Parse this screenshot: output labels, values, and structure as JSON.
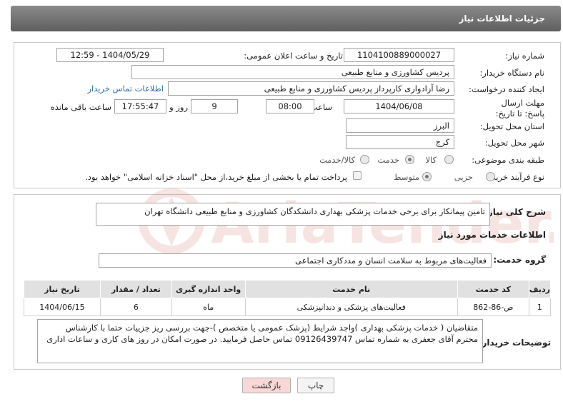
{
  "header": {
    "title": "جزئیات اطلاعات نیاز"
  },
  "form": {
    "need_number_label": "شماره نیاز:",
    "need_number": "1104100889000027",
    "announce_label": "تاریخ و ساعت اعلان عمومی:",
    "announce_value": "1404/05/29 - 12:59",
    "buyer_org_label": "نام دستگاه خریدار:",
    "buyer_org": "پردیس کشاورزی و منابع طبیعی",
    "requester_label": "ایجاد کننده درخواست:",
    "requester": "رضا آزادواری کارپرداز پردیس کشاورزی و منابع طبیعی",
    "contact_link": "اطلاعات تماس خریدار",
    "deadline_label": "مهلت ارسال پاسخ: تا تاریخ:",
    "deadline_date": "1404/06/08",
    "time_label": "ساعت",
    "deadline_time": "08:00",
    "days_value": "9",
    "days_label": "روز و",
    "remaining_time": "17:55:47",
    "remaining_label": "ساعت باقی مانده",
    "province_label": "استان محل تحویل:",
    "province": "البرز",
    "city_label": "شهر محل تحویل:",
    "city": "کرج",
    "category_label": "طبقه بندی موضوعی:",
    "category_options": [
      "کالا",
      "خدمت",
      "کالا/خدمت"
    ],
    "category_selected": "خدمت",
    "process_label": "نوع فرآیند خرید :",
    "process_options": [
      "جزیی",
      "متوسط"
    ],
    "process_selected": "متوسط",
    "payment_note": "پرداخت تمام یا بخشی از مبلغ خرید،از محل \"اسناد خزانه اسلامی\" خواهد بود."
  },
  "summary": {
    "label": "شرح کلی نیاز:",
    "text": "تامین پیمانکار برای برخی خدمات پزشکی بهداری دانشکدگان کشاورزی و منابع طبیعی دانشگاه تهران"
  },
  "services": {
    "section_title": "اطلاعات خدمات مورد نیاز",
    "group_label": "گروه خدمت:",
    "group_value": "فعالیت‌های مربوط به سلامت انسان و مددکاری اجتماعی",
    "columns": [
      "ردیف",
      "کد خدمت",
      "نام خدمت",
      "واحد اندازه گیری",
      "تعداد / مقدار",
      "تاریخ نیاز"
    ],
    "rows": [
      [
        "1",
        "ص-86-862",
        "فعالیت‌های پزشکی و دندانپزشکی",
        "ماه",
        "6",
        "1404/06/15"
      ]
    ]
  },
  "buyer_notes": {
    "label": "توضیحات خریدار:",
    "text": "متقاضیان ( خدمات پزشکی بهداری )واجد شرایط (پزشک عمومی یا متخصص )-جهت بررسی ریز جزییات حتما با کارشناس محترم آقای جعفری به شماره تماس 09126439747 تماس حاصل فرمایید. در صورت امکان در روز های کاری و ساعات اداری"
  },
  "buttons": {
    "print": "چاپ",
    "back": "بازگشت"
  },
  "watermark": {
    "text": "AriaTender.neT"
  },
  "colors": {
    "header": "#6e6e6e",
    "link": "#2a6fb0",
    "back_button": "#f8d7d7",
    "watermark": "#c0392b"
  }
}
